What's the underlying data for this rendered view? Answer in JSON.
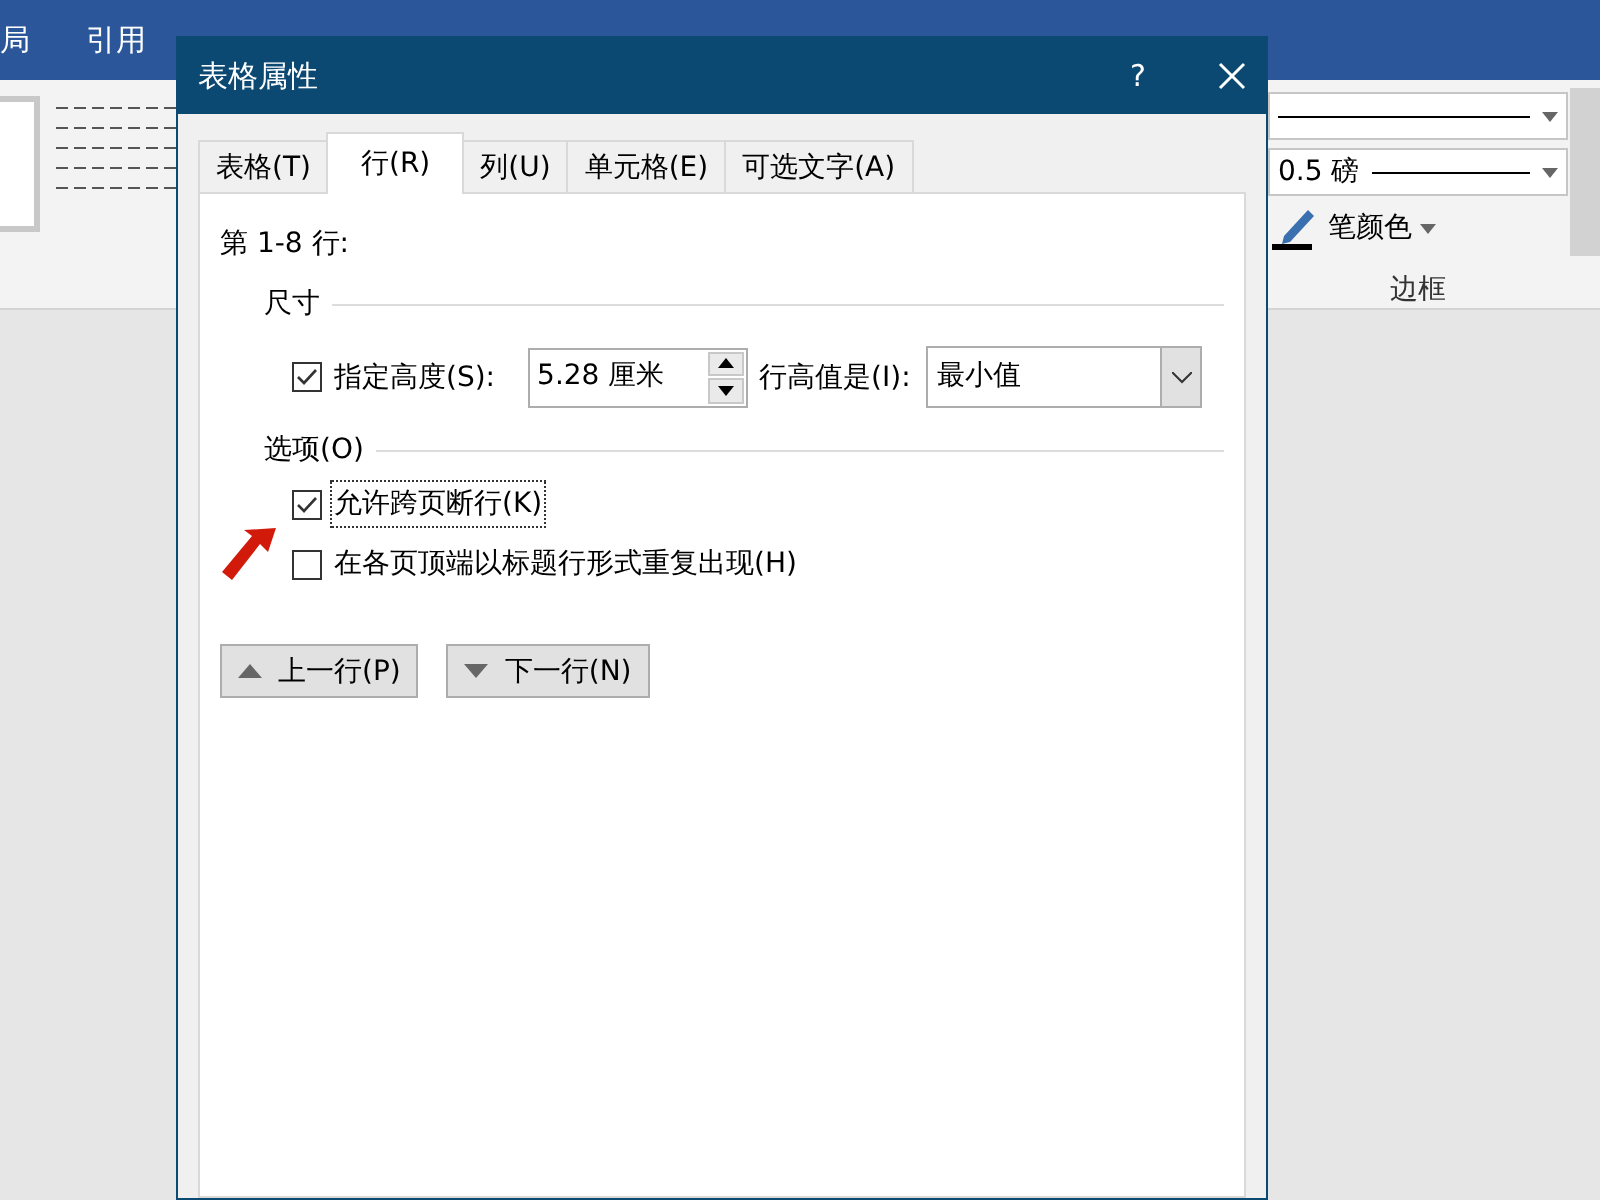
{
  "ribbon": {
    "tabs": [
      {
        "label": "局"
      },
      {
        "label": "引用"
      }
    ],
    "border_group": {
      "weight": "0.5 磅",
      "pen_color": "笔颜色",
      "group_label": "边框"
    }
  },
  "dialog": {
    "title": "表格属性",
    "help": "?",
    "tabs": [
      {
        "label": "表格(T)",
        "selected": false
      },
      {
        "label": "行(R)",
        "selected": true
      },
      {
        "label": "列(U)",
        "selected": false
      },
      {
        "label": "单元格(E)",
        "selected": false
      },
      {
        "label": "可选文字(A)",
        "selected": false
      }
    ],
    "rows_label": "第 1-8 行:",
    "size_section": "尺寸",
    "specify_height": {
      "label": "指定高度(S):",
      "checked": true
    },
    "height_value": "5.28 厘米",
    "height_rule_label": "行高值是(I):",
    "height_rule": "最小值",
    "options_section": "选项(O)",
    "options": [
      {
        "label": "允许跨页断行(K)",
        "checked": true,
        "focused": true
      },
      {
        "label": "在各页顶端以标题行形式重复出现(H)",
        "checked": false,
        "focused": false
      }
    ],
    "nav_buttons": [
      {
        "label": "上一行(P)",
        "kind": "up"
      },
      {
        "label": "下一行(N)",
        "kind": "down"
      }
    ]
  }
}
